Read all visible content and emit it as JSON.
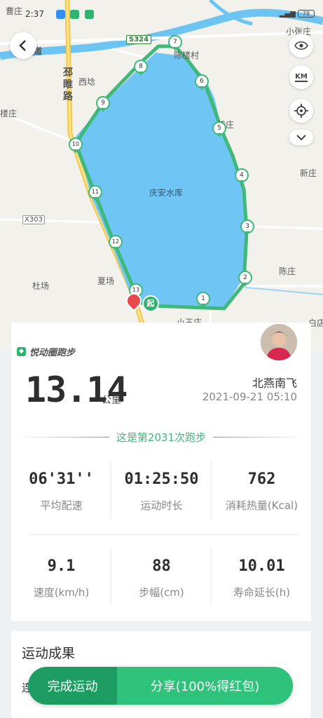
{
  "status_bar": {
    "time": "2:37",
    "battery": "78"
  },
  "map": {
    "road_s324": "S324",
    "road_x303": "X303",
    "road_vertical": "邳睢路",
    "road_left": "道",
    "reservoir": "庆安水库",
    "places": {
      "caozhuang": "曹庄",
      "xiaozhangzhuang": "小张庄",
      "xiling": "西埝",
      "shilou": "陈楼村",
      "lingzhuang": "陵庄",
      "xinzhuang": "新庄",
      "duchang": "杜场",
      "xiachang": "夏场",
      "chenzhuang": "陈庄",
      "xiaowang": "小王庄",
      "baidian": "白店",
      "left_edge": "楼庄"
    },
    "markers": [
      "1",
      "2",
      "3",
      "4",
      "5",
      "6",
      "7",
      "8",
      "9",
      "10",
      "11",
      "12",
      "13"
    ],
    "start_label": "起",
    "icons": {
      "back": "back-arrow-icon",
      "eye": "eye-icon",
      "km": "km-icon",
      "locate": "locate-icon",
      "expand": "chevron-down-icon"
    },
    "km_label": "KM"
  },
  "result": {
    "brand": "悦动圈跑步",
    "distance": "13.14",
    "distance_unit": "公里",
    "user_name": "北燕南飞",
    "datetime": "2021-09-21 05:10",
    "run_count": "这是第2031次跑步",
    "stats": [
      {
        "value": "06'31''",
        "label": "平均配速"
      },
      {
        "value": "01:25:50",
        "label": "运动时长"
      },
      {
        "value": "762",
        "label": "消耗热量(Kcal)"
      },
      {
        "value": "9.1",
        "label": "速度(km/h)"
      },
      {
        "value": "88",
        "label": "步幅(cm)"
      },
      {
        "value": "10.01",
        "label": "寿命延长(h)"
      }
    ]
  },
  "achievements": {
    "title": "运动成果",
    "sub": "连"
  },
  "actions": {
    "finish": "完成运动",
    "share": "分享(100%得红包)"
  },
  "colors": {
    "route": "#3fb87a",
    "water": "#6fc6f5",
    "accent": "#2fc27b"
  }
}
